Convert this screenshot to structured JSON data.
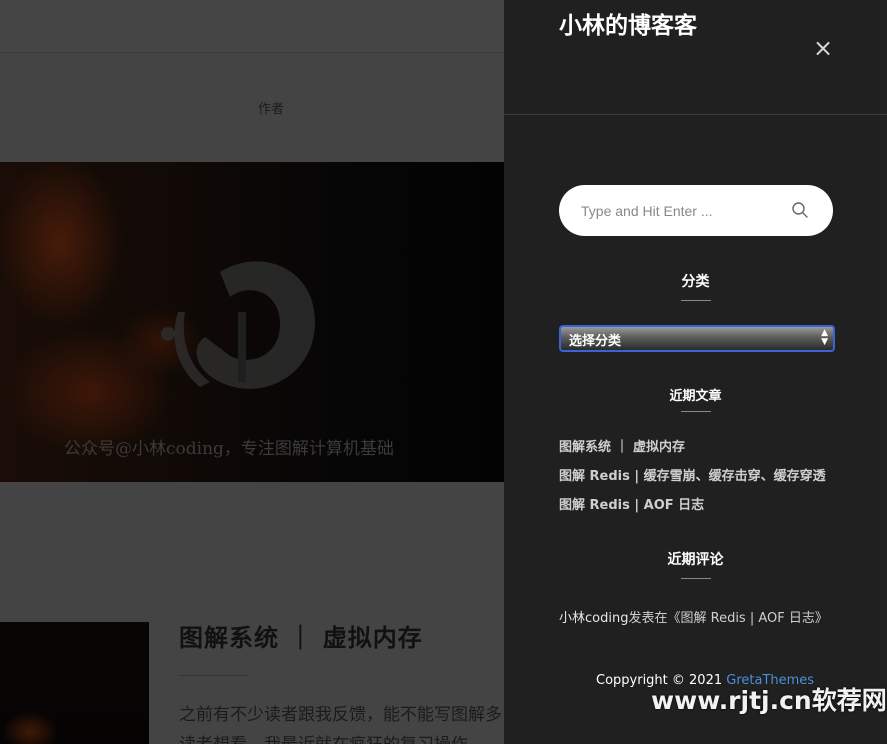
{
  "background": {
    "nav_author": "作者",
    "hero_caption": "公众号@小林coding，专注图解计算机基础",
    "post": {
      "title": "图解系统 ｜ 虚拟内存",
      "excerpt": "之前有不少读者跟我反馈，能不能写图解多读者想看，我最近就在疯狂的复习操作"
    }
  },
  "sidebar": {
    "site_title": "小林的博客客",
    "close_icon": "×",
    "search": {
      "placeholder": "Type and Hit Enter ..."
    },
    "categories": {
      "title": "分类",
      "selected": "选择分类"
    },
    "recent_posts": {
      "title": "近期文章",
      "items": [
        "图解系统 ｜ 虚拟内存",
        "图解 Redis | 缓存雪崩、缓存击穿、缓存穿透",
        "图解 Redis | AOF 日志"
      ]
    },
    "recent_comments": {
      "title": "近期评论",
      "author": "小林coding",
      "middle": "发表在",
      "post": "《图解 Redis | AOF 日志》"
    },
    "footer": {
      "copyright": "Coppyright © 2021 ",
      "credit": "GretaThemes"
    }
  },
  "watermark": "www.rjtj.cn软荐网",
  "colors": {
    "sidebar_bg": "#202020",
    "link_accent": "#4a90d9",
    "select_border": "#3a63d8"
  }
}
